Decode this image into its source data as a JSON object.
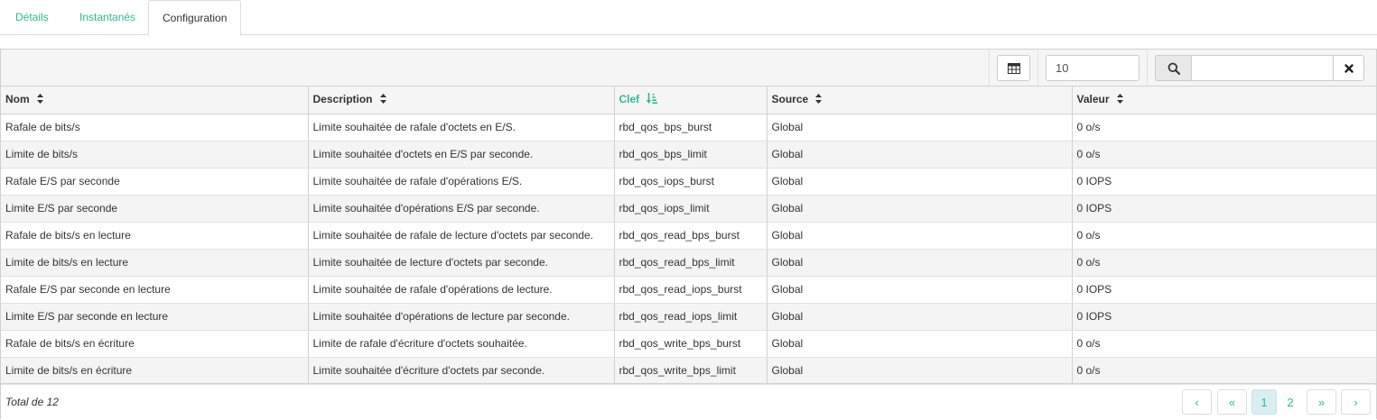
{
  "tabs": [
    {
      "label": "Détails"
    },
    {
      "label": "Instantanés"
    },
    {
      "label": "Configuration"
    }
  ],
  "toolbar": {
    "page_size": "10",
    "search_value": "",
    "icons": [
      "table-icon",
      "search-icon",
      "clear-icon"
    ]
  },
  "table": {
    "columns": [
      {
        "label": "Nom"
      },
      {
        "label": "Description"
      },
      {
        "label": "Clef"
      },
      {
        "label": "Source"
      },
      {
        "label": "Valeur"
      }
    ],
    "sorted_column": "Clef",
    "rows": [
      [
        "Rafale de bits/s",
        "Limite souhaitée de rafale d'octets en E/S.",
        "rbd_qos_bps_burst",
        "Global",
        "0 o/s"
      ],
      [
        "Limite de bits/s",
        "Limite souhaitée d'octets en E/S par seconde.",
        "rbd_qos_bps_limit",
        "Global",
        "0 o/s"
      ],
      [
        "Rafale E/S par seconde",
        "Limite souhaitée de rafale d'opérations E/S.",
        "rbd_qos_iops_burst",
        "Global",
        "0 IOPS"
      ],
      [
        "Limite E/S par seconde",
        "Limite souhaitée d'opérations E/S par seconde.",
        "rbd_qos_iops_limit",
        "Global",
        "0 IOPS"
      ],
      [
        "Rafale de bits/s en lecture",
        "Limite souhaitée de rafale de lecture d'octets par seconde.",
        "rbd_qos_read_bps_burst",
        "Global",
        "0 o/s"
      ],
      [
        "Limite de bits/s en lecture",
        "Limite souhaitée de lecture d'octets par seconde.",
        "rbd_qos_read_bps_limit",
        "Global",
        "0 o/s"
      ],
      [
        "Rafale E/S par seconde en lecture",
        "Limite souhaitée de rafale d'opérations de lecture.",
        "rbd_qos_read_iops_burst",
        "Global",
        "0 IOPS"
      ],
      [
        "Limite E/S par seconde en lecture",
        "Limite souhaitée d'opérations de lecture par seconde.",
        "rbd_qos_read_iops_limit",
        "Global",
        "0 IOPS"
      ],
      [
        "Rafale de bits/s en écriture",
        "Limite de rafale d'écriture d'octets souhaitée.",
        "rbd_qos_write_bps_burst",
        "Global",
        "0 o/s"
      ],
      [
        "Limite de bits/s en écriture",
        "Limite souhaitée d'écriture d'octets par seconde.",
        "rbd_qos_write_bps_limit",
        "Global",
        "0 o/s"
      ]
    ]
  },
  "footer": {
    "total": "Total de 12",
    "pages": [
      "1",
      "2"
    ],
    "current_page": "1",
    "nav": {
      "prev": "‹",
      "first": "«",
      "last": "»",
      "next": "›"
    }
  },
  "colors": {
    "accent": "#2bbb8f",
    "header_bg": "#f5f5f5",
    "stripe": "#f4f4f4"
  }
}
